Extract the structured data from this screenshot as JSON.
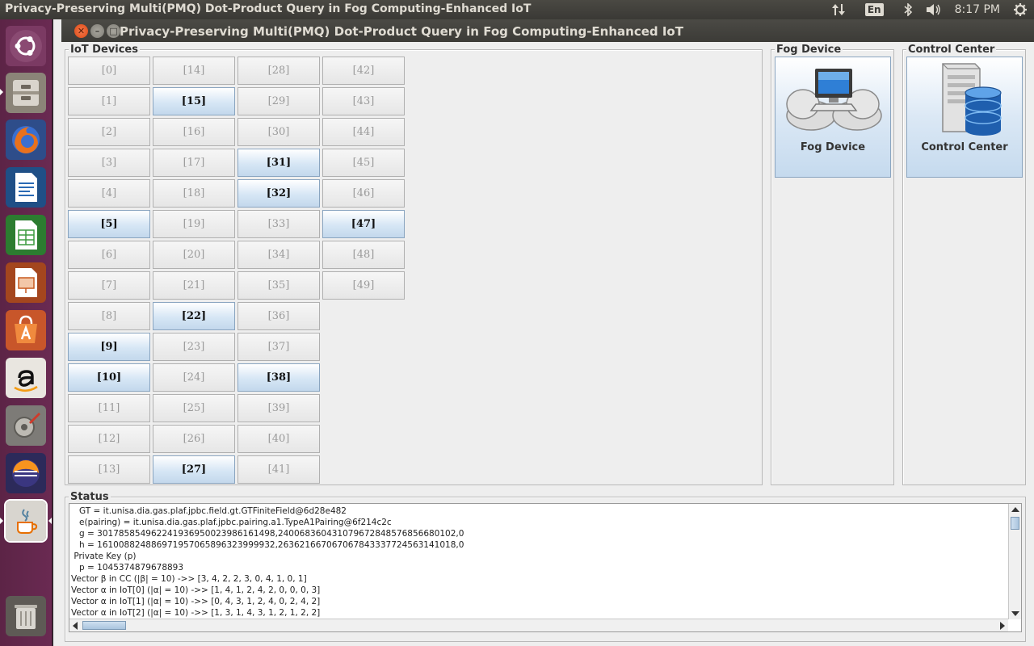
{
  "top_panel": {
    "title": "Privacy-Preserving Multi(PMQ) Dot-Product Query in Fog Computing-Enhanced IoT",
    "keyboard_layout": "En",
    "clock": "8:17 PM",
    "icons": [
      "network-arrows-icon",
      "keyboard-layout-icon",
      "bluetooth-icon",
      "volume-icon",
      "settings-gear-icon"
    ]
  },
  "launcher": {
    "items": [
      "ubuntu-dash-icon",
      "files-icon",
      "firefox-icon",
      "writer-icon",
      "calc-icon",
      "impress-icon",
      "software-center-icon",
      "amazon-icon",
      "system-settings-icon",
      "eclipse-icon",
      "java-icon",
      "trash-icon"
    ]
  },
  "window": {
    "title": "Privacy-Preserving Multi(PMQ) Dot-Product Query in Fog Computing-Enhanced IoT"
  },
  "iot_devices": {
    "legend": "IoT Devices",
    "columns": [
      [
        "[0]",
        "[1]",
        "[2]",
        "[3]",
        "[4]",
        "[5]",
        "[6]",
        "[7]",
        "[8]",
        "[9]",
        "[10]",
        "[11]",
        "[12]",
        "[13]"
      ],
      [
        "[14]",
        "[15]",
        "[16]",
        "[17]",
        "[18]",
        "[19]",
        "[20]",
        "[21]",
        "[22]",
        "[23]",
        "[24]",
        "[25]",
        "[26]",
        "[27]"
      ],
      [
        "[28]",
        "[29]",
        "[30]",
        "[31]",
        "[32]",
        "[33]",
        "[34]",
        "[35]",
        "[36]",
        "[37]",
        "[38]",
        "[39]",
        "[40]",
        "[41]"
      ],
      [
        "[42]",
        "[43]",
        "[44]",
        "[45]",
        "[46]",
        "[47]",
        "[48]",
        "[49]"
      ]
    ],
    "active": [
      5,
      9,
      10,
      15,
      22,
      27,
      31,
      32,
      38,
      47
    ]
  },
  "fog_device": {
    "legend": "Fog Device",
    "button_label": "Fog Device",
    "icon": "cloud-computer-icon"
  },
  "control_center": {
    "legend": "Control Center",
    "button_label": "Control Center",
    "icon": "server-database-icon"
  },
  "status": {
    "legend": "Status",
    "lines": [
      "   GT = it.unisa.dia.gas.plaf.jpbc.field.gt.GTFiniteField@6d28e482",
      "   e(pairing) = it.unisa.dia.gas.plaf.jpbc.pairing.a1.TypeA1Pairing@6f214c2c",
      "   g = 301785854962241936950023986161498,240068360431079672848576856680102,0",
      "   h = 161008824886971957065896323999932,263621667067067843337724563141018,0",
      " Private Key (p)",
      "   p = 1045374879678893",
      "Vector β in CC (|β| = 10) ->> [3, 4, 2, 2, 3, 0, 4, 1, 0, 1]",
      "Vector α in IoT[0] (|α| = 10) ->> [1, 4, 1, 2, 4, 2, 0, 0, 0, 3]",
      "Vector α in IoT[1] (|α| = 10) ->> [0, 4, 3, 1, 2, 4, 0, 2, 4, 2]",
      "Vector α in IoT[2] (|α| = 10) ->> [1, 3, 1, 4, 3, 1, 2, 1, 2, 2]"
    ]
  }
}
